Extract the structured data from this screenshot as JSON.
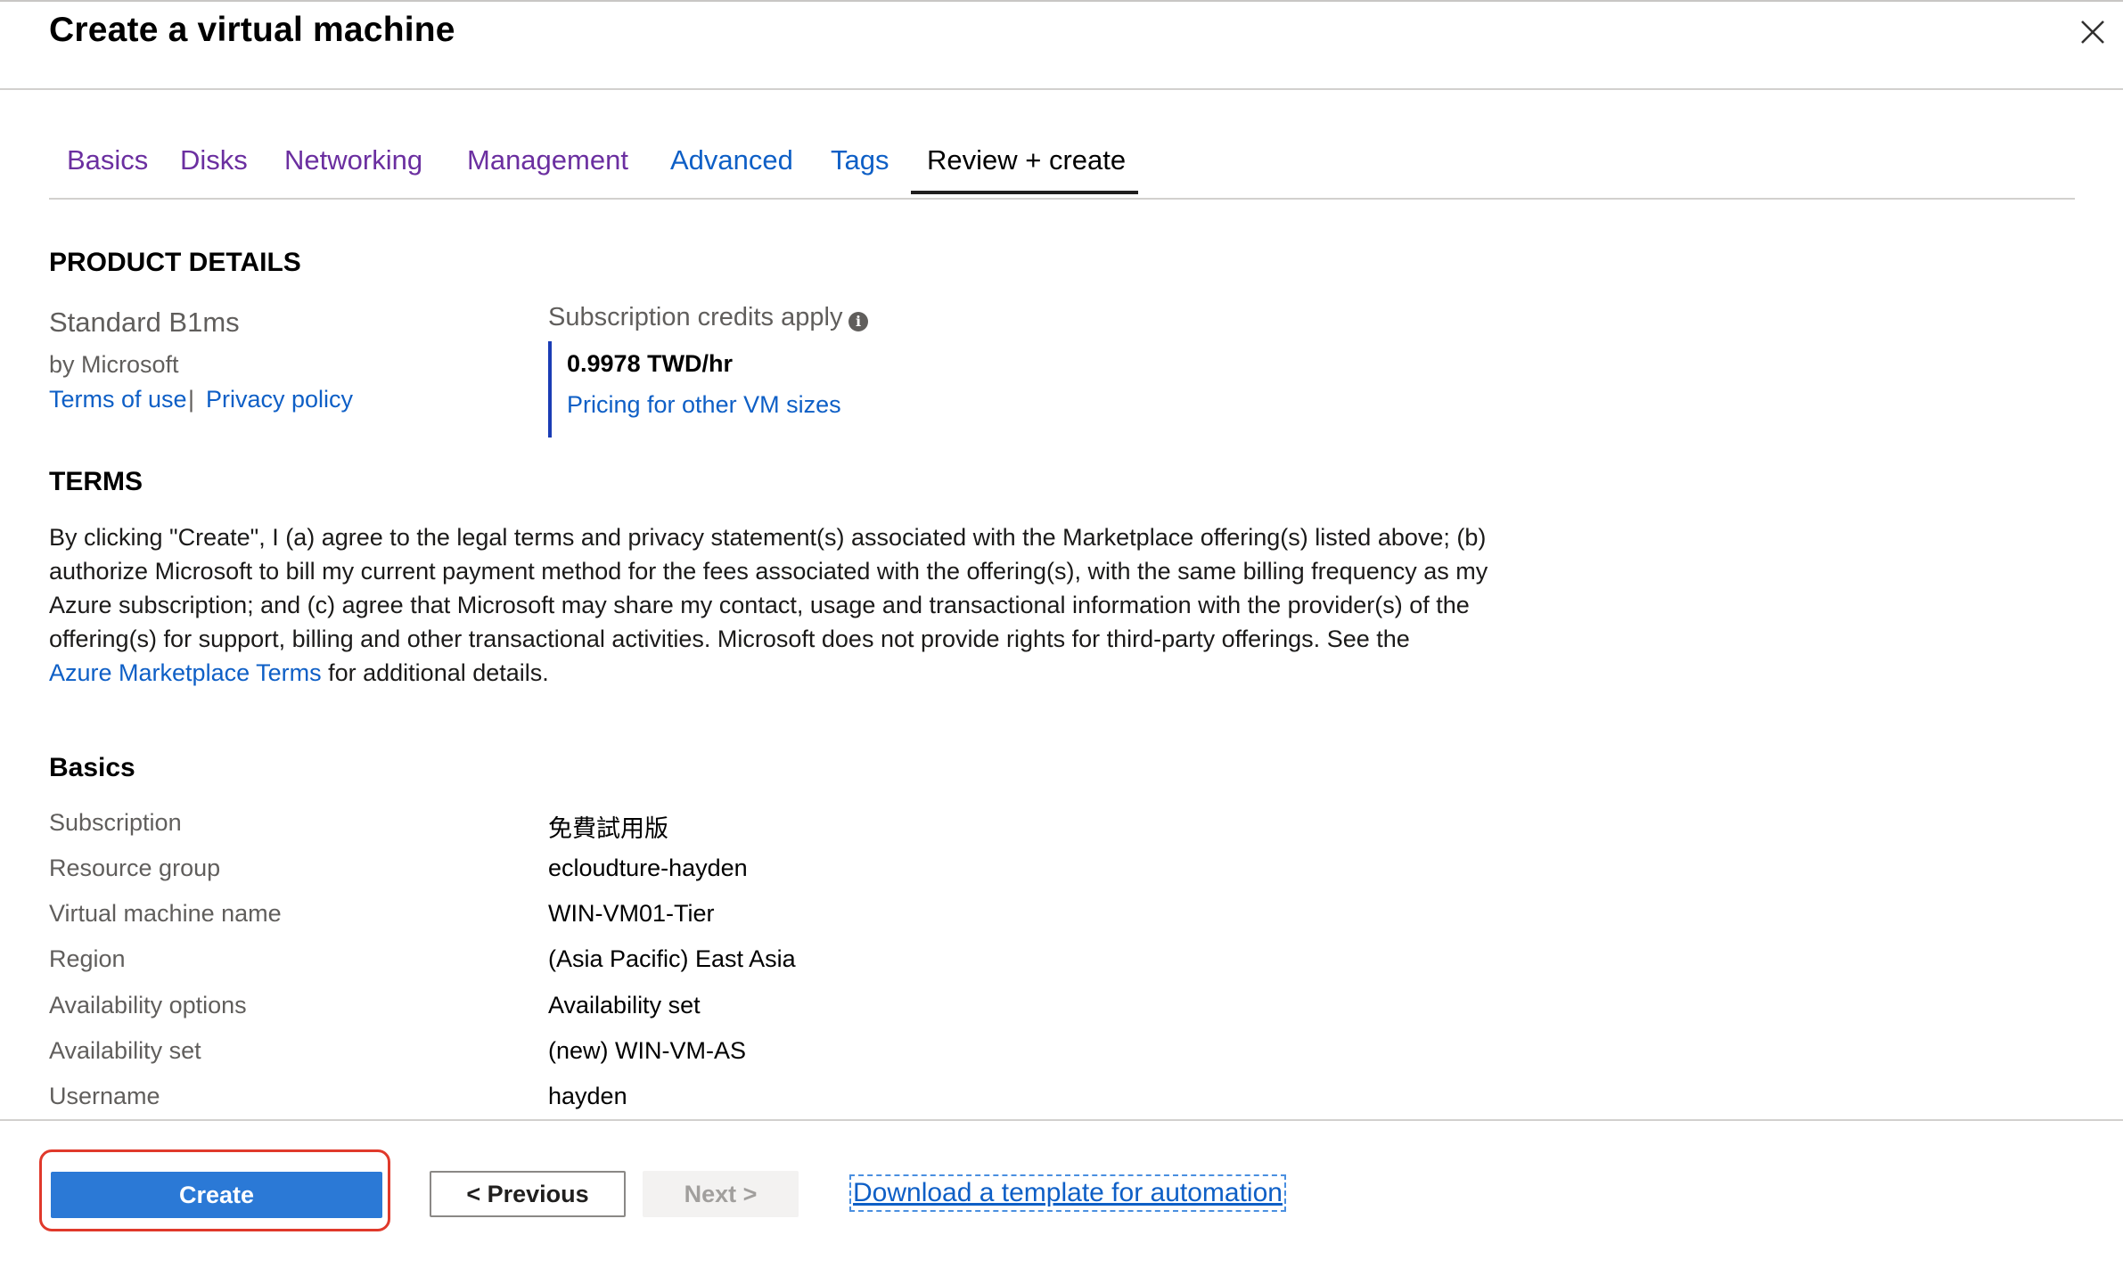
{
  "header": {
    "title": "Create a virtual machine"
  },
  "tabs": [
    {
      "label": "Basics"
    },
    {
      "label": "Disks"
    },
    {
      "label": "Networking"
    },
    {
      "label": "Management"
    },
    {
      "label": "Advanced"
    },
    {
      "label": "Tags"
    },
    {
      "label": "Review + create",
      "active": true
    }
  ],
  "product": {
    "heading": "PRODUCT DETAILS",
    "name": "Standard B1ms",
    "publisher": "by Microsoft",
    "terms_link": "Terms of use",
    "separator": "|",
    "privacy_link": "Privacy policy",
    "credits_label": "Subscription credits apply",
    "price": "0.9978 TWD/hr",
    "pricing_link": "Pricing for other VM sizes"
  },
  "terms": {
    "heading": "TERMS",
    "body": "By clicking \"Create\", I (a) agree to the legal terms and privacy statement(s) associated with the Marketplace offering(s) listed above; (b) authorize Microsoft to bill my current payment method for the fees associated with the offering(s), with the same billing frequency as my Azure subscription; and (c) agree that Microsoft may share my contact, usage and transactional information with the provider(s) of the offering(s) for support, billing and other transactional activities. Microsoft does not provide rights for third-party offerings. See the",
    "marketplace_link": "Azure Marketplace Terms",
    "tail": "for additional details."
  },
  "basics": {
    "heading": "Basics",
    "rows": [
      {
        "label": "Subscription",
        "value": "免費試用版"
      },
      {
        "label": "Resource group",
        "value": "ecloudture-hayden"
      },
      {
        "label": "Virtual machine name",
        "value": "WIN-VM01-Tier"
      },
      {
        "label": "Region",
        "value": "(Asia Pacific) East Asia"
      },
      {
        "label": "Availability options",
        "value": "Availability set"
      },
      {
        "label": "Availability set",
        "value": "(new) WIN-VM-AS"
      },
      {
        "label": "Username",
        "value": "hayden"
      }
    ]
  },
  "footer": {
    "create_label": "Create",
    "previous_label": "< Previous",
    "next_label": "Next >",
    "download_label": "Download a template for automation"
  },
  "colors": {
    "accent_blue": "#2b79d6",
    "link_blue": "#0e5fc6",
    "visited_purple": "#6b2fa0",
    "highlight_red": "#e0392b"
  }
}
